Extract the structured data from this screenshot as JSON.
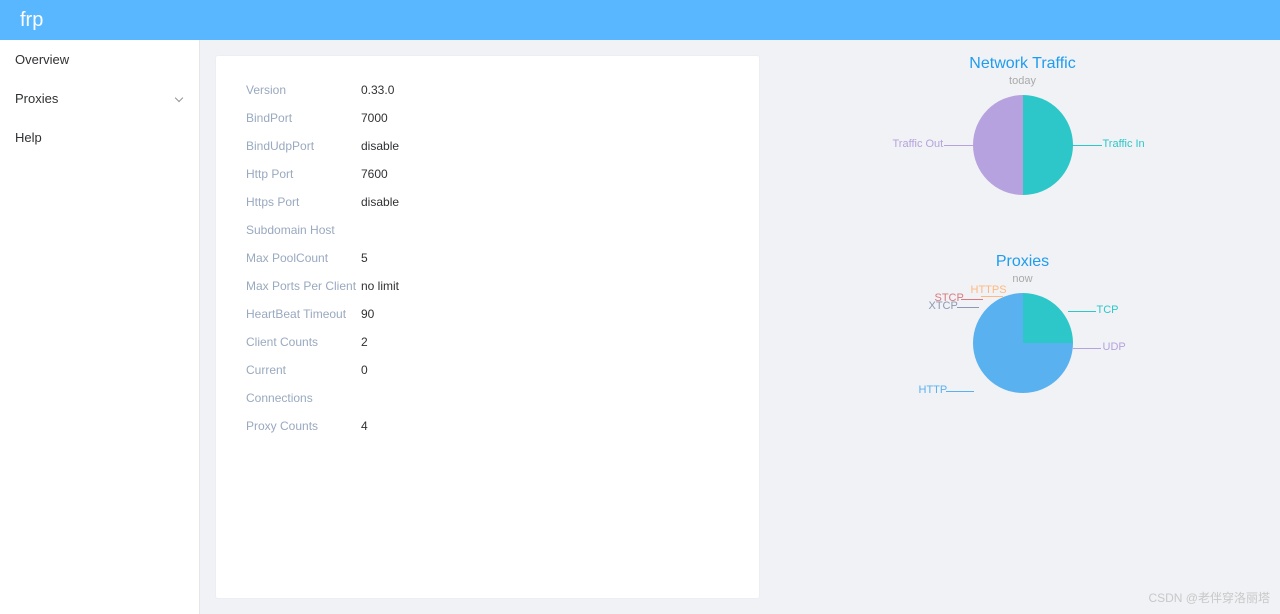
{
  "header": {
    "title": "frp"
  },
  "sidebar": {
    "items": [
      {
        "label": "Overview"
      },
      {
        "label": "Proxies",
        "expandable": true
      },
      {
        "label": "Help"
      }
    ]
  },
  "info": {
    "rows": [
      {
        "label": "Version",
        "value": "0.33.0"
      },
      {
        "label": "BindPort",
        "value": "7000"
      },
      {
        "label": "BindUdpPort",
        "value": "disable"
      },
      {
        "label": "Http Port",
        "value": "7600"
      },
      {
        "label": "Https Port",
        "value": "disable"
      },
      {
        "label": "Subdomain Host",
        "value": ""
      },
      {
        "label": "Max PoolCount",
        "value": "5"
      },
      {
        "label": "Max Ports Per Client",
        "value": "no limit"
      },
      {
        "label": "HeartBeat Timeout",
        "value": "90"
      },
      {
        "label": "Client Counts",
        "value": "2"
      },
      {
        "label": "Current",
        "value": "0"
      },
      {
        "label": "Connections",
        "value": ""
      },
      {
        "label": "Proxy Counts",
        "value": "4"
      }
    ]
  },
  "charts": {
    "traffic": {
      "title": "Network Traffic",
      "subtitle": "today",
      "labels": {
        "in": "Traffic In",
        "out": "Traffic Out"
      }
    },
    "proxies": {
      "title": "Proxies",
      "subtitle": "now",
      "labels": {
        "tcp": "TCP",
        "udp": "UDP",
        "http": "HTTP",
        "https": "HTTPS",
        "stcp": "STCP",
        "xtcp": "XTCP"
      }
    }
  },
  "chart_data": [
    {
      "type": "pie",
      "title": "Network Traffic",
      "subtitle": "today",
      "series": [
        {
          "name": "Traffic In",
          "value": 50,
          "color": "#2ec7c9"
        },
        {
          "name": "Traffic Out",
          "value": 50,
          "color": "#b6a2de"
        }
      ]
    },
    {
      "type": "pie",
      "title": "Proxies",
      "subtitle": "now",
      "series": [
        {
          "name": "TCP",
          "value": 1,
          "color": "#2ec7c9"
        },
        {
          "name": "UDP",
          "value": 0,
          "color": "#b6a2de"
        },
        {
          "name": "HTTP",
          "value": 3,
          "color": "#5ab1ef"
        },
        {
          "name": "HTTPS",
          "value": 0,
          "color": "#ffb980"
        },
        {
          "name": "STCP",
          "value": 0,
          "color": "#d87a80"
        },
        {
          "name": "XTCP",
          "value": 0,
          "color": "#8d98b3"
        }
      ]
    }
  ],
  "colors": {
    "teal": "#2ec7c9",
    "purple": "#b6a2de",
    "blue": "#5ab1ef",
    "orange": "#ffb980",
    "red": "#d87a80",
    "grayblue": "#8d98b3"
  },
  "watermark": "CSDN @老伴穿洛丽塔"
}
